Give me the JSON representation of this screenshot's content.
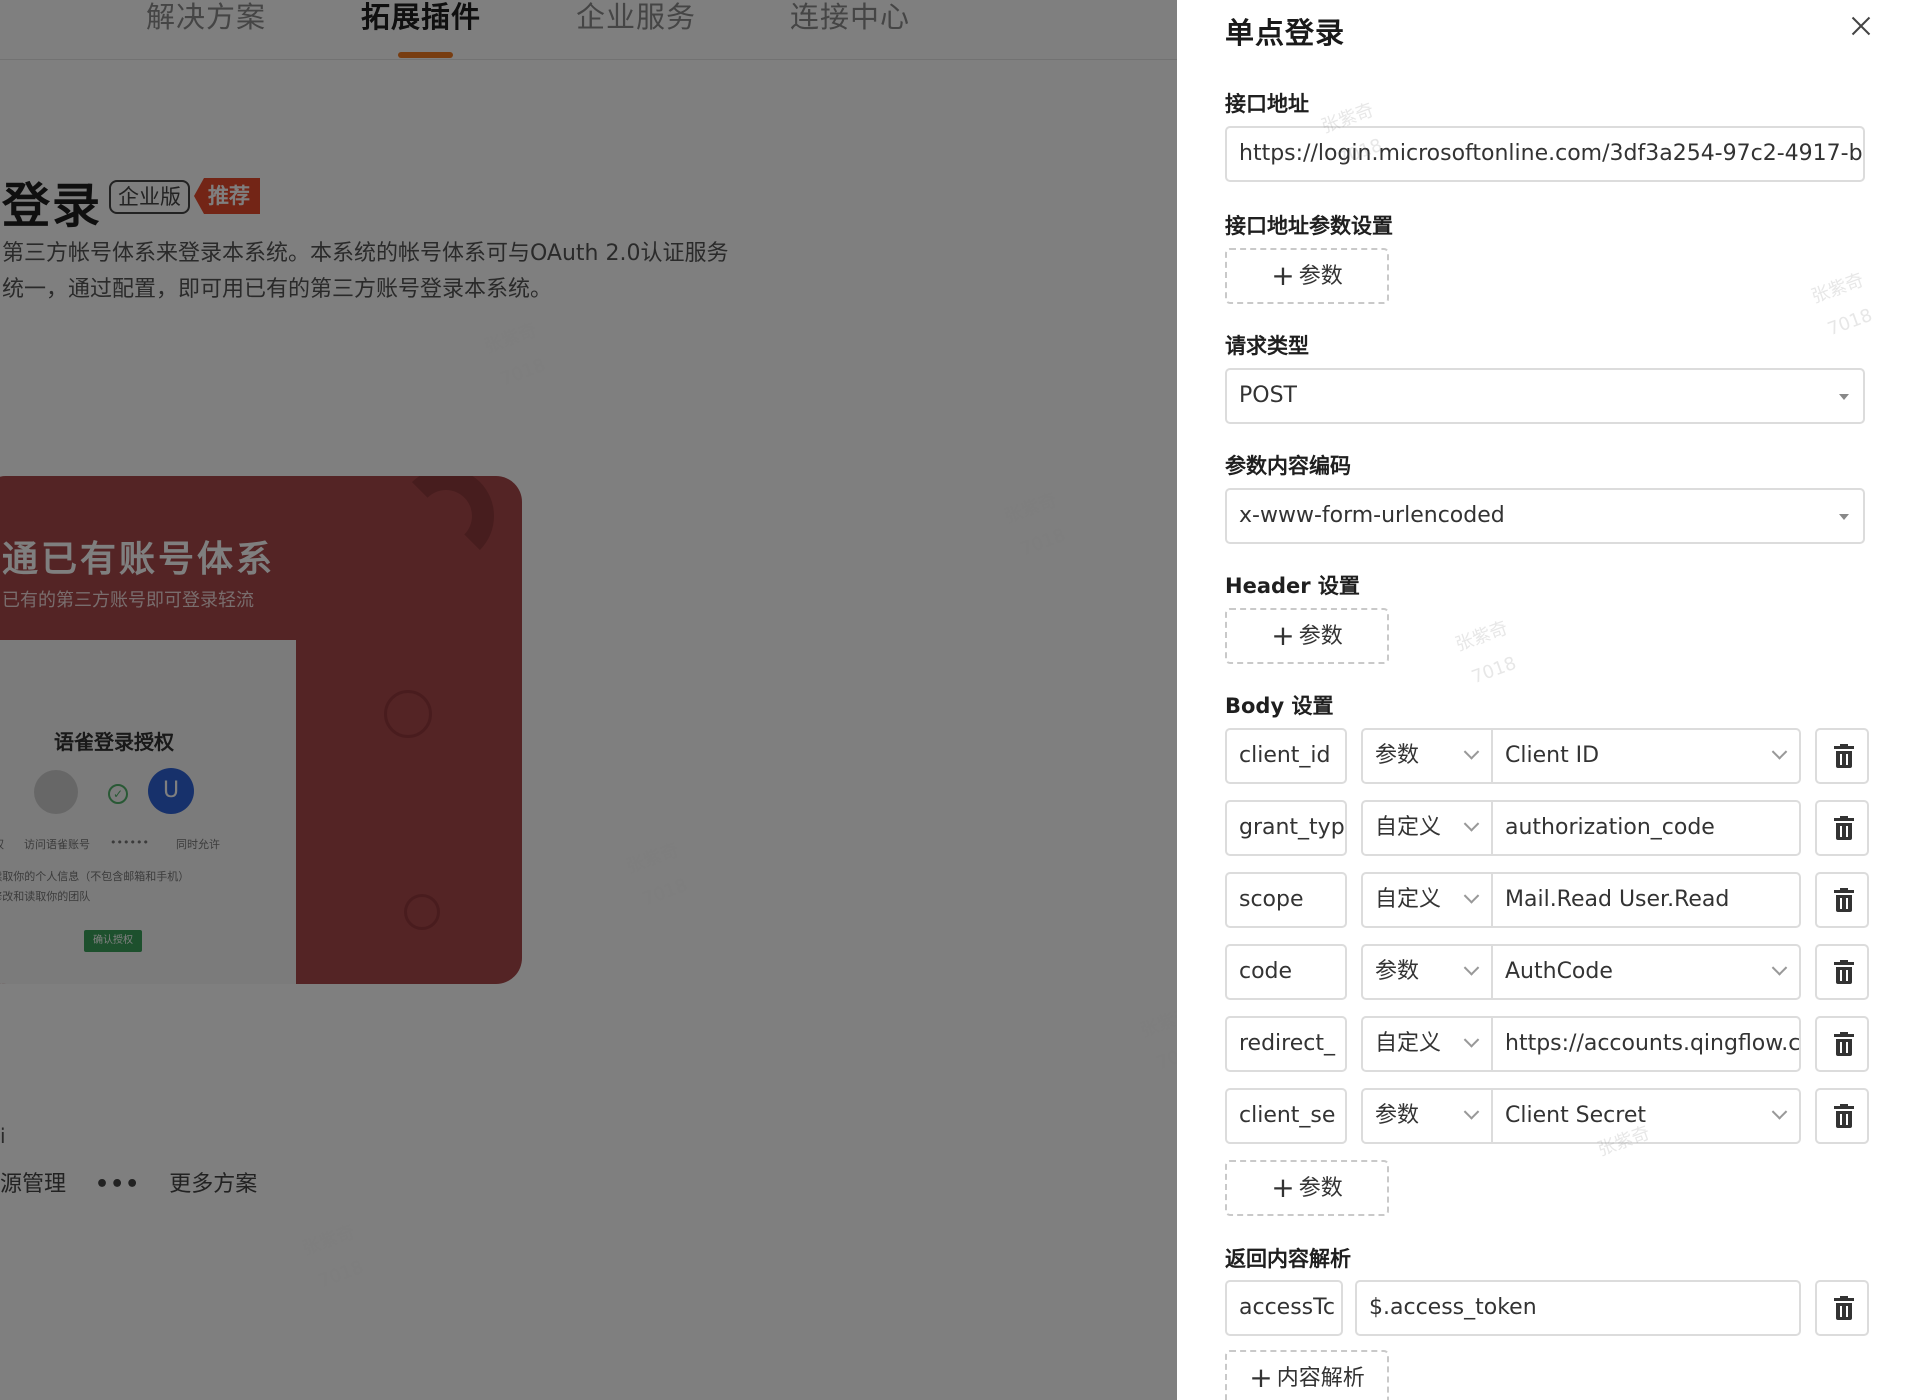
{
  "background": {
    "nav_tabs": [
      {
        "label": "解决方案"
      },
      {
        "label": "拓展插件"
      },
      {
        "label": "企业服务"
      },
      {
        "label": "连接中心"
      }
    ],
    "page_title": "登录",
    "badge_enterprise": "企业版",
    "badge_recommend": "推荐",
    "description_line1": "第三方帐号体系来登录本系统。本系统的帐号体系可与OAuth 2.0认证服务",
    "description_line2": "统一，通过配置，即可用已有的第三方账号登录本系统。",
    "hero": {
      "title": "通已有账号体系",
      "subtitle": "已有的第三方账号即可登录轻流",
      "card_title": "语雀登录授权",
      "avatar_letter": "U",
      "card_caption_1": "授权",
      "card_caption_2": "访问语雀账号",
      "card_caption_3": "••••••",
      "card_caption_4": "同时允许",
      "card_option_1": "✓读取你的个人信息（不包含邮箱和手机）",
      "card_option_2": "✓修改和读取你的团队",
      "card_button": "确认授权"
    },
    "bottom_text": "i",
    "bottom_item_1": "源管理",
    "bottom_dots": "•••",
    "bottom_item_2": "更多方案"
  },
  "drawer": {
    "title": "单点登录",
    "endpoint": {
      "label": "接口地址",
      "value": "https://login.microsoftonline.com/3df3a254-97c2-4917-b"
    },
    "endpoint_params": {
      "label": "接口地址参数设置",
      "add_label": "参数"
    },
    "request_type": {
      "label": "请求类型",
      "value": "POST"
    },
    "encoding": {
      "label": "参数内容编码",
      "value": "x-www-form-urlencoded"
    },
    "header": {
      "label": "Header 设置",
      "add_label": "参数"
    },
    "body": {
      "label": "Body 设置",
      "rows": [
        {
          "name": "client_id",
          "type": "参数",
          "value": "Client ID",
          "value_is_select": true
        },
        {
          "name": "grant_typ",
          "type": "自定义",
          "value": "authorization_code",
          "value_is_select": false
        },
        {
          "name": "scope",
          "type": "自定义",
          "value": "Mail.Read User.Read",
          "value_is_select": false
        },
        {
          "name": "code",
          "type": "参数",
          "value": "AuthCode",
          "value_is_select": true
        },
        {
          "name": "redirect_",
          "type": "自定义",
          "value": "https://accounts.qingflow.c",
          "value_is_select": false
        },
        {
          "name": "client_se",
          "type": "参数",
          "value": "Client Secret",
          "value_is_select": true
        }
      ],
      "add_label": "参数"
    },
    "response": {
      "label": "返回内容解析",
      "rows": [
        {
          "name": "accessTc",
          "value": "$.access_token"
        }
      ],
      "add_label": "内容解析"
    }
  },
  "watermark": {
    "name": "张紫奇",
    "id": "7018"
  },
  "colors": {
    "accent": "#f07a23",
    "badge_red": "#e64a2c",
    "hero_bg": "#a8484a"
  },
  "icons": [
    "close-icon",
    "plus-icon",
    "chevron-down-icon",
    "trash-icon",
    "caret-down-icon"
  ]
}
